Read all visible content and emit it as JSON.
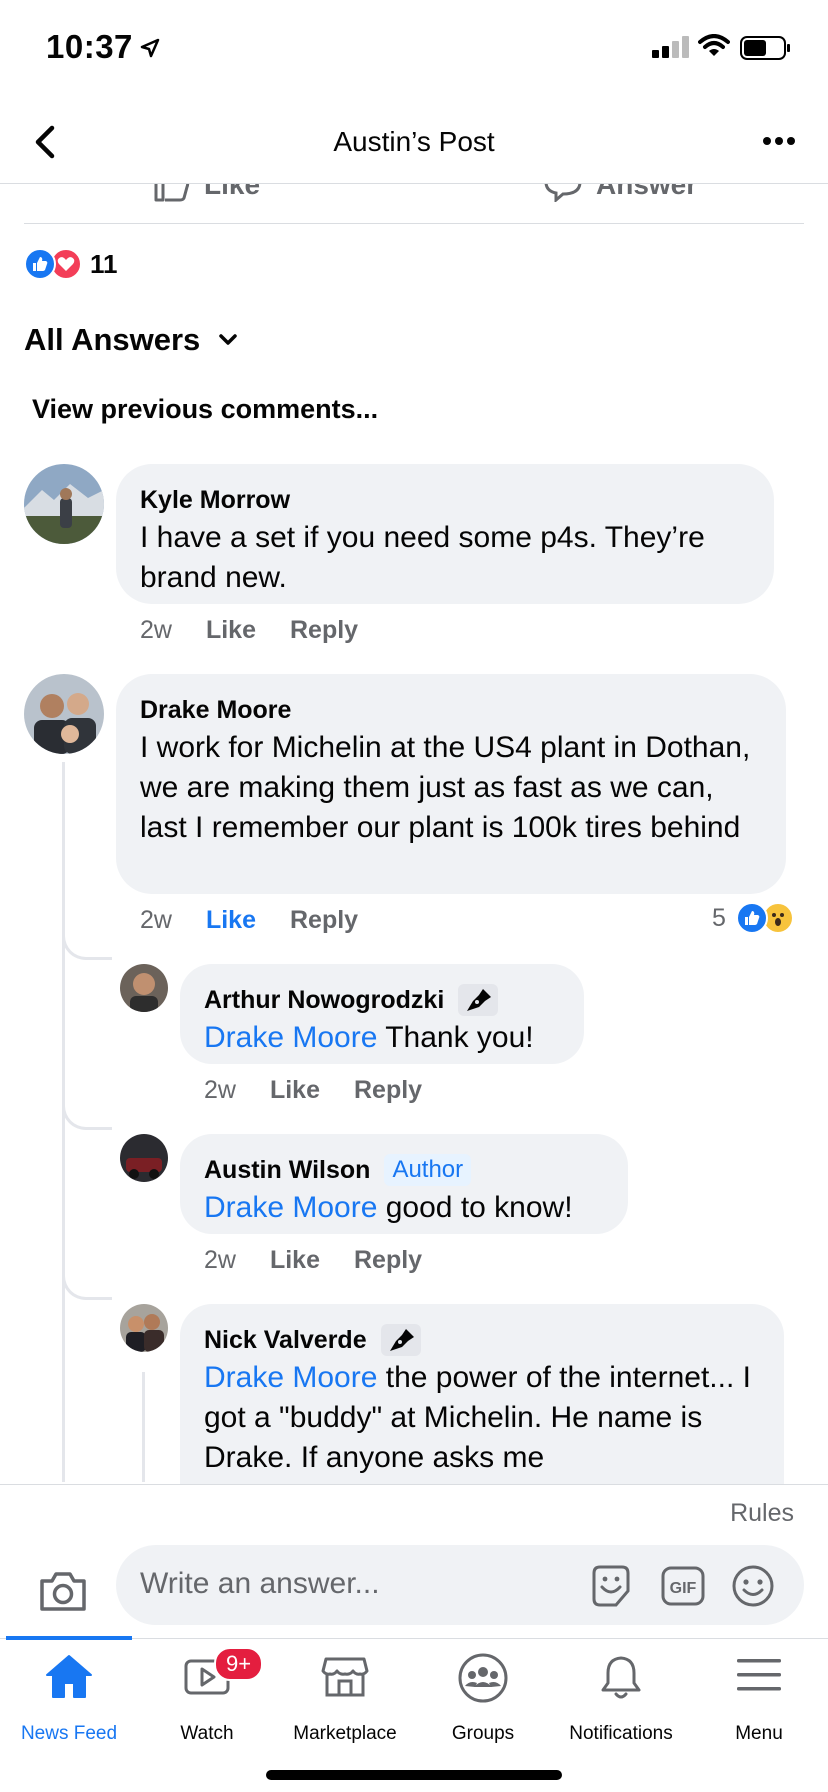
{
  "status_bar": {
    "time": "10:37"
  },
  "header": {
    "title": "Austin’s Post"
  },
  "post_actions": {
    "like_label": "Like",
    "answer_label": "Answer"
  },
  "reactions": {
    "count": "11"
  },
  "answers": {
    "filter_label": "All Answers",
    "view_previous": "View previous comments..."
  },
  "comments": [
    {
      "name": "Kyle Morrow",
      "text": "I have a set if you need some p4s. They’re brand new.",
      "time": "2w",
      "like": "Like",
      "reply": "Reply"
    },
    {
      "name": "Drake Moore",
      "text": "I work for Michelin at the US4 plant in Dothan, we are making them just as fast as we can, last I remember our plant is 100k tires behind",
      "time": "2w",
      "like": "Like",
      "reply": "Reply",
      "reaction_count": "5"
    }
  ],
  "replies": [
    {
      "name": "Arthur Nowogrodzki",
      "mention": "Drake Moore",
      "text": " Thank you!",
      "time": "2w",
      "like": "Like",
      "reply": "Reply"
    },
    {
      "name": "Austin Wilson",
      "badge": "Author",
      "mention": "Drake Moore",
      "text": " good to know!",
      "time": "2w",
      "like": "Like",
      "reply": "Reply"
    },
    {
      "name": "Nick Valverde",
      "mention": "Drake Moore",
      "text": " the power of the internet... I got a \"buddy\" at Michelin. He name is Drake. If anyone asks me"
    }
  ],
  "composer": {
    "rules": "Rules",
    "placeholder": "Write an answer...",
    "gif": "GIF"
  },
  "tabbar": {
    "news_feed": "News Feed",
    "watch": "Watch",
    "watch_badge": "9+",
    "marketplace": "Marketplace",
    "groups": "Groups",
    "notifications": "Notifications",
    "menu": "Menu"
  },
  "colors": {
    "accent": "#1877f2",
    "bubble": "#f0f2f5",
    "secondary_text": "#65676b",
    "badge_red": "#e41e3f"
  }
}
